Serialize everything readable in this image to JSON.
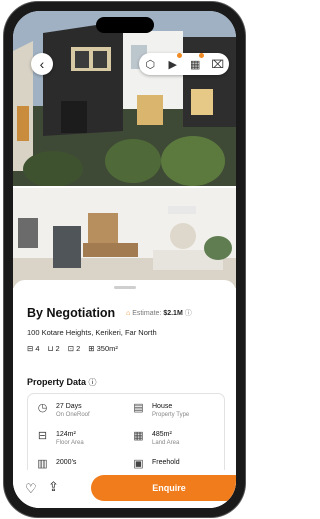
{
  "gallery": {
    "icons": [
      "back-arrow-icon",
      "3d-cube-icon",
      "video-icon",
      "floorplan-icon",
      "map-icon"
    ]
  },
  "listing": {
    "price": "By Negotiation",
    "estimate_label": "Estimate:",
    "estimate_value": "$2.1M",
    "address": "100 Kotare Heights, Kerikeri, Far North",
    "beds": "4",
    "baths": "2",
    "cars": "2",
    "land": "350m²"
  },
  "property_data": {
    "title": "Property Data",
    "items": [
      {
        "value": "27 Days",
        "label": "On OneRoof"
      },
      {
        "value": "House",
        "label": "Property Type"
      },
      {
        "value": "124m²",
        "label": "Floor Area"
      },
      {
        "value": "485m²",
        "label": "Land Area"
      },
      {
        "value": "2000's",
        "label": ""
      },
      {
        "value": "Freehold",
        "label": ""
      }
    ]
  },
  "actions": {
    "enquire": "Enquire"
  },
  "colors": {
    "accent": "#f07c1b"
  }
}
